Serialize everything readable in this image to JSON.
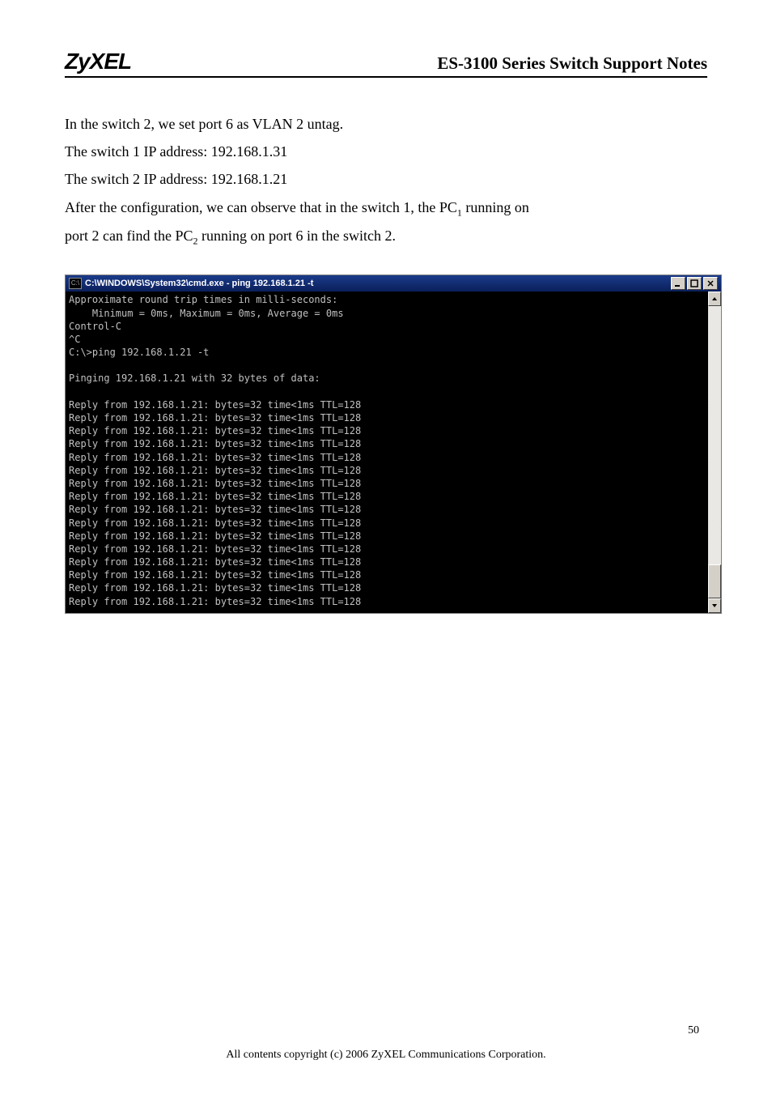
{
  "header": {
    "brand": "ZyXEL",
    "doc_title": "ES-3100 Series Switch Support Notes"
  },
  "body": {
    "line1": "In the switch 2, we set port 6 as VLAN 2 untag.",
    "line2": "The switch 1 IP address: 192.168.1.31",
    "line3": "The switch 2 IP address: 192.168.1.21",
    "line4_a": "After the configuration, we can observe that in the switch 1, the PC",
    "line4_sub1": "1",
    "line4_b": " running on",
    "line5_a": "port 2 can find the PC",
    "line5_sub2": "2",
    "line5_b": "  running on port 6 in the switch 2."
  },
  "console": {
    "titlebar_prefix": "C:\\",
    "titlebar_text": "C:\\WINDOWS\\System32\\cmd.exe - ping 192.168.1.21 -t",
    "lines": [
      "Approximate round trip times in milli-seconds:",
      "    Minimum = 0ms, Maximum = 0ms, Average = 0ms",
      "Control-C",
      "^C",
      "C:\\>ping 192.168.1.21 -t",
      "",
      "Pinging 192.168.1.21 with 32 bytes of data:",
      "",
      "Reply from 192.168.1.21: bytes=32 time<1ms TTL=128",
      "Reply from 192.168.1.21: bytes=32 time<1ms TTL=128",
      "Reply from 192.168.1.21: bytes=32 time<1ms TTL=128",
      "Reply from 192.168.1.21: bytes=32 time<1ms TTL=128",
      "Reply from 192.168.1.21: bytes=32 time<1ms TTL=128",
      "Reply from 192.168.1.21: bytes=32 time<1ms TTL=128",
      "Reply from 192.168.1.21: bytes=32 time<1ms TTL=128",
      "Reply from 192.168.1.21: bytes=32 time<1ms TTL=128",
      "Reply from 192.168.1.21: bytes=32 time<1ms TTL=128",
      "Reply from 192.168.1.21: bytes=32 time<1ms TTL=128",
      "Reply from 192.168.1.21: bytes=32 time<1ms TTL=128",
      "Reply from 192.168.1.21: bytes=32 time<1ms TTL=128",
      "Reply from 192.168.1.21: bytes=32 time<1ms TTL=128",
      "Reply from 192.168.1.21: bytes=32 time<1ms TTL=128",
      "Reply from 192.168.1.21: bytes=32 time<1ms TTL=128",
      "Reply from 192.168.1.21: bytes=32 time<1ms TTL=128"
    ]
  },
  "footer": {
    "page_number": "50",
    "copyright": "All contents copyright (c) 2006 ZyXEL Communications Corporation."
  }
}
